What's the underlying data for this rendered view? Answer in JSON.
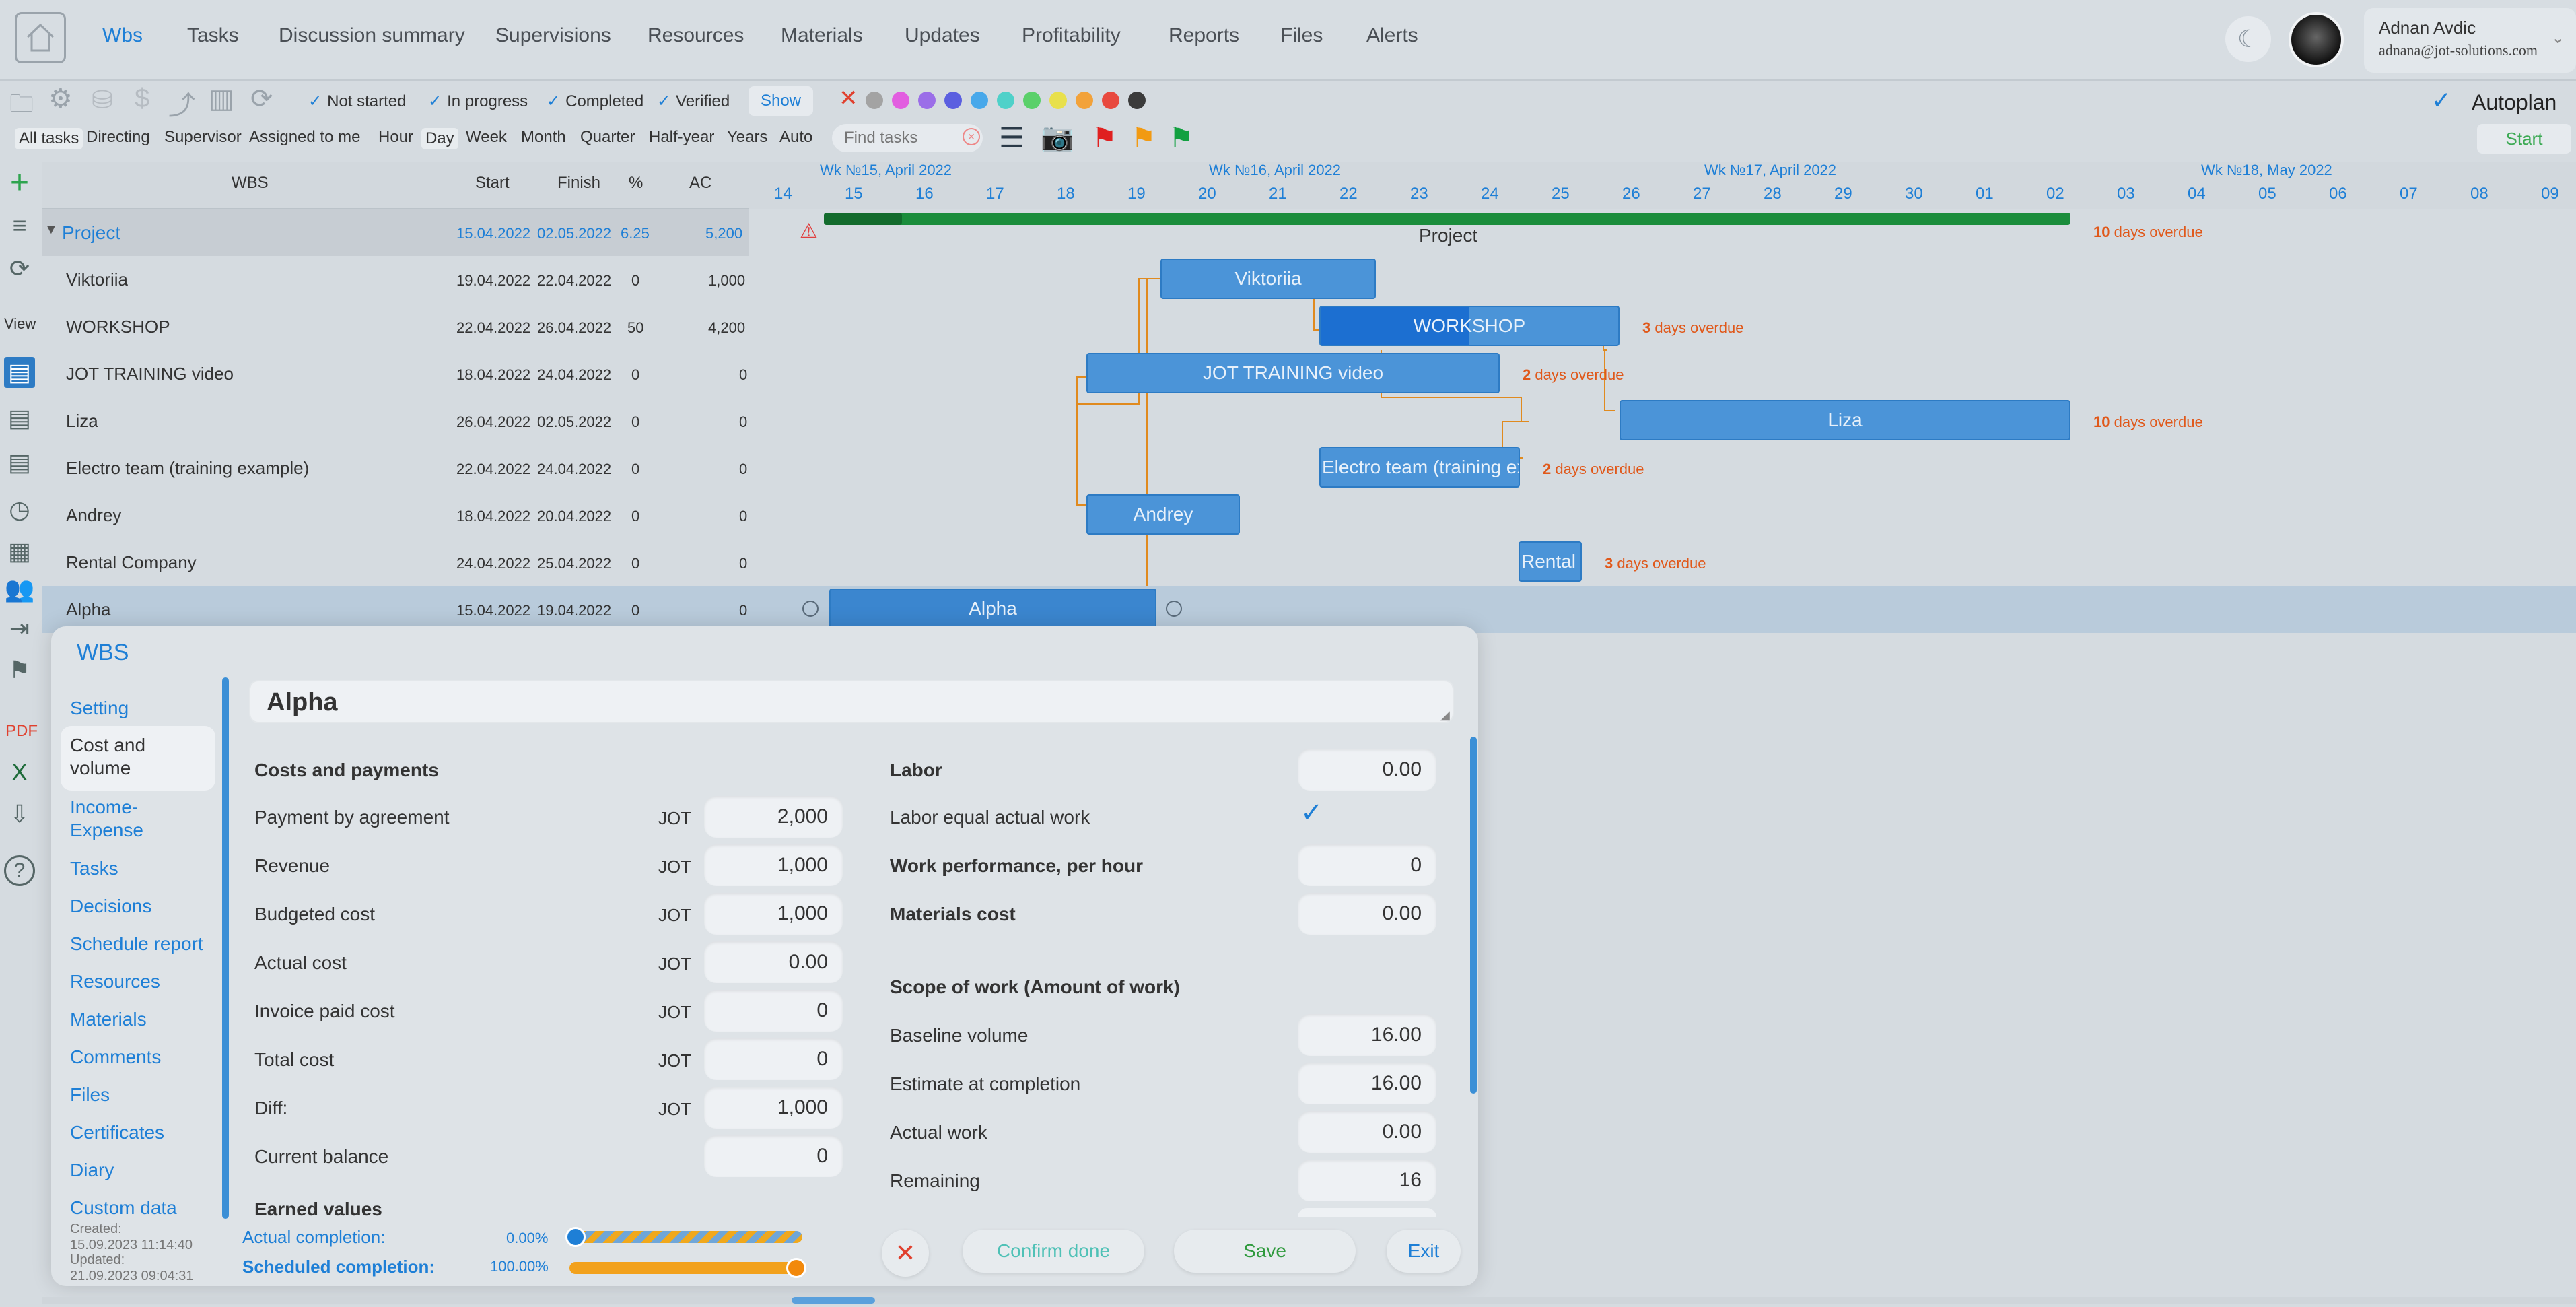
{
  "nav": {
    "tabs": [
      "Wbs",
      "Tasks",
      "Discussion summary",
      "Supervisions",
      "Resources",
      "Materials",
      "Updates",
      "Profitability",
      "Reports",
      "Files",
      "Alerts"
    ],
    "active_tab": "Wbs",
    "user_name": "Adnan Avdic",
    "user_email": "adnana@jot-solutions.com"
  },
  "filters": {
    "status": [
      "Not started",
      "In progress",
      "Completed",
      "Verified"
    ],
    "show_label": "Show",
    "colors": [
      "#a3a3a3",
      "#e25ee0",
      "#9b6ee8",
      "#5b5fe0",
      "#48a8ea",
      "#4fd1c9",
      "#5ad06a",
      "#e8e04c",
      "#f2a23a",
      "#e8493f",
      "#3b3b3b"
    ]
  },
  "toolbar2": {
    "views": [
      "All tasks",
      "Directing",
      "Supervisor",
      "Assigned to me"
    ],
    "scales": [
      "Hour",
      "Day",
      "Week",
      "Month",
      "Quarter",
      "Half-year",
      "Years",
      "Auto"
    ],
    "find_placeholder": "Find tasks",
    "autoplan_label": "Autoplan",
    "start_label": "Start"
  },
  "sidebar_left": {
    "view_label": "View",
    "pdf_label": "PDF"
  },
  "table": {
    "headers": {
      "wbs": "WBS",
      "start": "Start",
      "finish": "Finish",
      "pct": "%",
      "ac": "AC"
    },
    "rows": [
      {
        "name": "Project",
        "start": "15.04.2022",
        "finish": "02.05.2022",
        "pct": "6.25",
        "ac": "5,200"
      },
      {
        "name": "Viktoriia",
        "start": "19.04.2022",
        "finish": "22.04.2022",
        "pct": "0",
        "ac": "1,000"
      },
      {
        "name": "WORKSHOP",
        "start": "22.04.2022",
        "finish": "26.04.2022",
        "pct": "50",
        "ac": "4,200"
      },
      {
        "name": "JOT TRAINING video",
        "start": "18.04.2022",
        "finish": "24.04.2022",
        "pct": "0",
        "ac": "0"
      },
      {
        "name": "Liza",
        "start": "26.04.2022",
        "finish": "02.05.2022",
        "pct": "0",
        "ac": "0"
      },
      {
        "name": "Electro team (training example)",
        "start": "22.04.2022",
        "finish": "24.04.2022",
        "pct": "0",
        "ac": "0"
      },
      {
        "name": "Andrey",
        "start": "18.04.2022",
        "finish": "20.04.2022",
        "pct": "0",
        "ac": "0"
      },
      {
        "name": "Rental Company",
        "start": "24.04.2022",
        "finish": "25.04.2022",
        "pct": "0",
        "ac": "0"
      },
      {
        "name": "Alpha",
        "start": "15.04.2022",
        "finish": "19.04.2022",
        "pct": "0",
        "ac": "0"
      }
    ]
  },
  "gantt": {
    "weeks": [
      "Wk №15, April 2022",
      "Wk №16, April 2022",
      "Wk №17, April 2022",
      "Wk №18, May 2022"
    ],
    "days": [
      "14",
      "15",
      "16",
      "17",
      "18",
      "19",
      "20",
      "21",
      "22",
      "23",
      "24",
      "25",
      "26",
      "27",
      "28",
      "29",
      "30",
      "01",
      "02",
      "03",
      "04",
      "05",
      "06",
      "07",
      "08",
      "09"
    ],
    "bars": {
      "project": "Project",
      "viktoriia": "Viktoriia",
      "workshop": "WORKSHOP",
      "jot": "JOT TRAINING video",
      "liza": "Liza",
      "electro": "Electro team (training exa",
      "andrey": "Andrey",
      "rental": "Rental C",
      "alpha": "Alpha"
    },
    "overdue": {
      "project_n": "10",
      "workshop_n": "3",
      "jot_n": "2",
      "liza_n": "10",
      "electro_n": "2",
      "rental_n": "3",
      "suffix": "days overdue"
    },
    "workshop_progress": 0.5
  },
  "modal": {
    "title": "WBS",
    "nav": [
      "Setting",
      "Cost and volume",
      "Income-Expense",
      "Tasks",
      "Decisions",
      "Schedule report",
      "Resources",
      "Materials",
      "Comments",
      "Files",
      "Certificates",
      "Diary",
      "Custom data"
    ],
    "active_nav": "Cost and volume",
    "task_name": "Alpha",
    "costs_header": "Costs and payments",
    "currency": "JOT",
    "costs": [
      {
        "label": "Payment by agreement",
        "value": "2,000",
        "cur": true
      },
      {
        "label": "Revenue",
        "value": "1,000",
        "cur": true
      },
      {
        "label": "Budgeted cost",
        "value": "1,000",
        "cur": true
      },
      {
        "label": "Actual cost",
        "value": "0.00",
        "cur": true
      },
      {
        "label": "Invoice paid cost",
        "value": "0",
        "cur": true
      },
      {
        "label": "Total cost",
        "value": "0",
        "cur": true
      },
      {
        "label": "Diff:",
        "value": "1,000",
        "cur": true
      },
      {
        "label": "Current balance",
        "value": "0",
        "cur": false
      }
    ],
    "earned_values_header": "Earned values",
    "labor_label": "Labor",
    "labor_value": "0.00",
    "labor_equal_label": "Labor equal actual work",
    "work_perf_label": "Work performance, per hour",
    "work_perf_value": "0",
    "materials_cost_label": "Materials cost",
    "materials_cost_value": "0.00",
    "scope_header": "Scope of work (Amount of work)",
    "scope": [
      {
        "label": "Baseline volume",
        "value": "16.00"
      },
      {
        "label": "Estimate at completion",
        "value": "16.00"
      },
      {
        "label": "Actual work",
        "value": "0.00"
      },
      {
        "label": "Remaining",
        "value": "16"
      }
    ],
    "actual_completion_label": "Actual completion:",
    "actual_completion_pct": "0.00%",
    "actual_completion_value": 0.0,
    "scheduled_completion_label": "Scheduled completion:",
    "scheduled_completion_pct": "100.00%",
    "scheduled_completion_value": 1.0,
    "created_label": "Created:",
    "created": "15.09.2023 11:14:40",
    "updated_label": "Updated:",
    "updated": "21.09.2023 09:04:31",
    "buttons": {
      "confirm": "Confirm done",
      "save": "Save",
      "exit": "Exit"
    }
  }
}
